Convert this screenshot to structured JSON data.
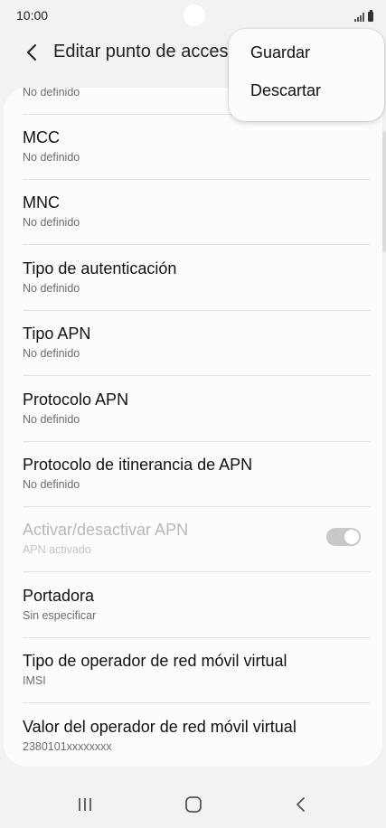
{
  "status_bar": {
    "time": "10:00",
    "icons": [
      "signal-icon",
      "battery-icon"
    ]
  },
  "app_bar": {
    "title": "Editar punto de acceso",
    "back_icon": "back-arrow-icon"
  },
  "partial_item": {
    "subtitle": "No definido"
  },
  "settings": [
    {
      "title": "MCC",
      "subtitle": "No definido"
    },
    {
      "title": "MNC",
      "subtitle": "No definido"
    },
    {
      "title": "Tipo de autenticación",
      "subtitle": "No definido"
    },
    {
      "title": "Tipo APN",
      "subtitle": "No definido"
    },
    {
      "title": "Protocolo APN",
      "subtitle": "No definido"
    },
    {
      "title": "Protocolo de itinerancia de APN",
      "subtitle": "No definido"
    },
    {
      "title": "Activar/desactivar APN",
      "subtitle": "APN activado",
      "toggle": true,
      "disabled": true
    },
    {
      "title": "Portadora",
      "subtitle": "Sin especificar"
    },
    {
      "title": "Tipo de operador de red móvil virtual",
      "subtitle": "IMSI"
    },
    {
      "title": "Valor del operador de red móvil virtual",
      "subtitle": "2380101xxxxxxxx"
    }
  ],
  "popup_menu": {
    "items": [
      {
        "label": "Guardar"
      },
      {
        "label": "Descartar"
      }
    ]
  },
  "nav_bar": {
    "icons": [
      "recent-apps-icon",
      "home-icon",
      "back-icon"
    ]
  },
  "colors": {
    "background": "#f2f2f2",
    "card": "#fcfcfc",
    "subtitle": "#6d6d6d",
    "disabled": "#b8b8b8"
  }
}
